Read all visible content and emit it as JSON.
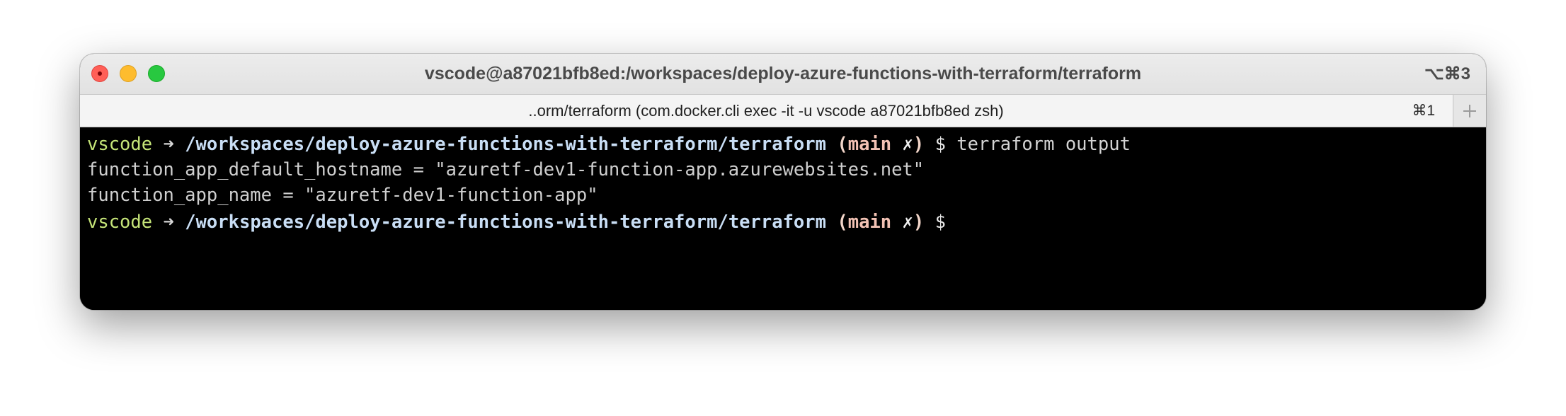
{
  "window": {
    "title": "vscode@a87021bfb8ed:/workspaces/deploy-azure-functions-with-terraform/terraform",
    "shortcut": "⌥⌘3"
  },
  "tab": {
    "label": "..orm/terraform (com.docker.cli exec -it -u vscode a87021bfb8ed zsh)",
    "shortcut": "⌘1",
    "new_tab_icon": "plus-icon"
  },
  "terminal": {
    "prompt1": {
      "user": "vscode",
      "arrow": "➜",
      "path": "/workspaces/deploy-azure-functions-with-terraform/terraform",
      "open_paren": "(",
      "branch": "main",
      "dirty": "✗",
      "close_paren": ")",
      "symbol": "$",
      "command": "terraform output"
    },
    "output": [
      "function_app_default_hostname = \"azuretf-dev1-function-app.azurewebsites.net\"",
      "function_app_name = \"azuretf-dev1-function-app\""
    ],
    "prompt2": {
      "user": "vscode",
      "arrow": "➜",
      "path": "/workspaces/deploy-azure-functions-with-terraform/terraform",
      "open_paren": "(",
      "branch": "main",
      "dirty": "✗",
      "close_paren": ")",
      "symbol": "$"
    }
  },
  "colors": {
    "user": "#c5e478",
    "path": "#c9def5",
    "branch": "#f2c2b4",
    "background": "#000000",
    "close": "#ff5f57",
    "minimize": "#febc2e",
    "zoom": "#28c840"
  }
}
